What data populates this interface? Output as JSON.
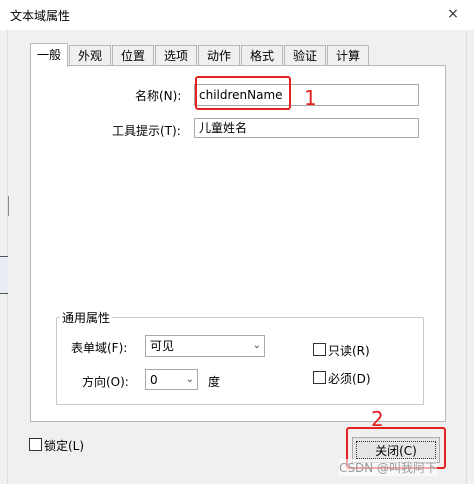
{
  "window": {
    "title": "文本域属性",
    "close_glyph": "×"
  },
  "tabs": [
    "一般",
    "外观",
    "位置",
    "选项",
    "动作",
    "格式",
    "验证",
    "计算"
  ],
  "form": {
    "name_label": "名称(N):",
    "name_value": "childrenName",
    "tooltip_label": "工具提示(T):",
    "tooltip_value": "儿童姓名"
  },
  "annotations": {
    "one": "1",
    "two": "2"
  },
  "common": {
    "title": "通用属性",
    "form_field_label": "表单域(F):",
    "form_field_value": "可见",
    "direction_label": "方向(O):",
    "direction_value": "0",
    "direction_unit": "度",
    "readonly_label": "只读(R)",
    "required_label": "必须(D)"
  },
  "footer": {
    "lock_label": "锁定(L)",
    "close_button": "关闭(C)",
    "watermark": "CSDN @叫我阿下"
  },
  "colors": {
    "annotation_red": "#e32222",
    "tab_border": "#b9b9b9"
  }
}
